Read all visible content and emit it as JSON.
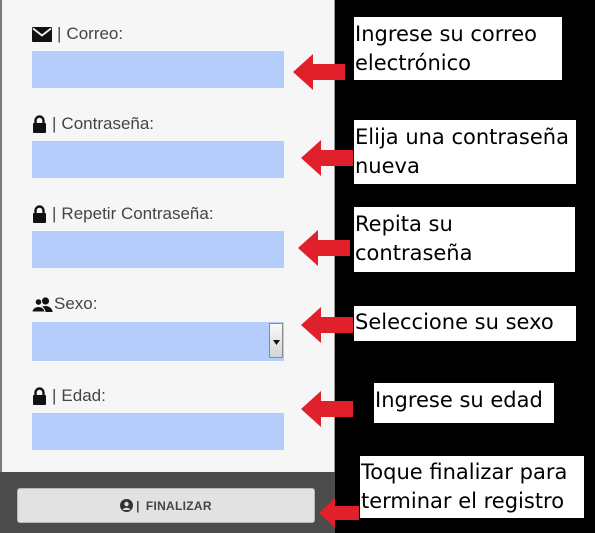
{
  "form": {
    "fields": [
      {
        "label": "Correo:",
        "separator": "|",
        "icon": "envelope-icon",
        "value": ""
      },
      {
        "label": "Contraseña:",
        "separator": "|",
        "icon": "lock-icon",
        "value": ""
      },
      {
        "label": "Repetir Contraseña:",
        "separator": "|",
        "icon": "lock-icon",
        "value": ""
      },
      {
        "label": "Sexo:",
        "icon": "users-icon",
        "value": ""
      },
      {
        "label": "Edad:",
        "separator": "|",
        "icon": "lock-icon",
        "value": ""
      }
    ],
    "finalize_button": {
      "label": "FINALIZAR",
      "separator": "|",
      "icon": "user-circle-icon"
    }
  },
  "annotations": [
    {
      "line1": "Ingrese su correo",
      "line2": "electrónico"
    },
    {
      "line1": "Elija una contraseña",
      "line2": "nueva"
    },
    {
      "line1": "Repita su",
      "line2": "contraseña"
    },
    {
      "line1": "Seleccione su sexo"
    },
    {
      "line1": "Ingrese su edad"
    },
    {
      "line1": "Toque finalizar para",
      "line2": "terminar el registro"
    }
  ],
  "colors": {
    "input_fill": "#b5cdfb",
    "panel_background": "#f6f6f6",
    "footer_bar": "#4b4b4b",
    "arrow_red": "#e0202a",
    "page_background": "#000000"
  }
}
